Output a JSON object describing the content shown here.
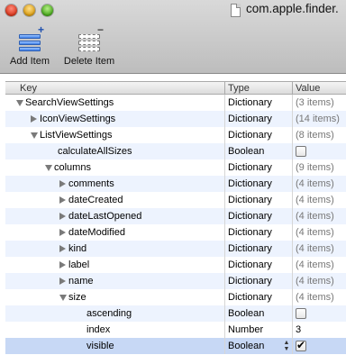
{
  "window": {
    "title": "com.apple.finder."
  },
  "toolbar": {
    "add_label": "Add Item",
    "delete_label": "Delete Item"
  },
  "columns": {
    "key": "Key",
    "type": "Type",
    "value": "Value"
  },
  "rows": [
    {
      "name": "row-searchviewsettings",
      "key": "SearchViewSettings",
      "depth": 0,
      "disclosure": "open",
      "type": "Dictionary",
      "value": "(3 items)"
    },
    {
      "name": "row-iconviewsettings",
      "key": "IconViewSettings",
      "depth": 1,
      "disclosure": "closed",
      "type": "Dictionary",
      "value": "(14 items)"
    },
    {
      "name": "row-listviewsettings",
      "key": "ListViewSettings",
      "depth": 1,
      "disclosure": "open",
      "type": "Dictionary",
      "value": "(8 items)"
    },
    {
      "name": "row-calculateallsizes",
      "key": "calculateAllSizes",
      "depth": 2,
      "disclosure": "none",
      "type": "Boolean",
      "checked": false
    },
    {
      "name": "row-columns",
      "key": "columns",
      "depth": 2,
      "disclosure": "open",
      "type": "Dictionary",
      "value": "(9 items)"
    },
    {
      "name": "row-comments",
      "key": "comments",
      "depth": 3,
      "disclosure": "closed",
      "type": "Dictionary",
      "value": "(4 items)"
    },
    {
      "name": "row-datecreated",
      "key": "dateCreated",
      "depth": 3,
      "disclosure": "closed",
      "type": "Dictionary",
      "value": "(4 items)"
    },
    {
      "name": "row-datelastopened",
      "key": "dateLastOpened",
      "depth": 3,
      "disclosure": "closed",
      "type": "Dictionary",
      "value": "(4 items)"
    },
    {
      "name": "row-datemodified",
      "key": "dateModified",
      "depth": 3,
      "disclosure": "closed",
      "type": "Dictionary",
      "value": "(4 items)"
    },
    {
      "name": "row-kind",
      "key": "kind",
      "depth": 3,
      "disclosure": "closed",
      "type": "Dictionary",
      "value": "(4 items)"
    },
    {
      "name": "row-label",
      "key": "label",
      "depth": 3,
      "disclosure": "closed",
      "type": "Dictionary",
      "value": "(4 items)"
    },
    {
      "name": "row-name",
      "key": "name",
      "depth": 3,
      "disclosure": "closed",
      "type": "Dictionary",
      "value": "(4 items)"
    },
    {
      "name": "row-size",
      "key": "size",
      "depth": 3,
      "disclosure": "open",
      "type": "Dictionary",
      "value": "(4 items)"
    },
    {
      "name": "row-ascending",
      "key": "ascending",
      "depth": 4,
      "disclosure": "none",
      "type": "Boolean",
      "checked": false
    },
    {
      "name": "row-index",
      "key": "index",
      "depth": 4,
      "disclosure": "none",
      "type": "Number",
      "value": "3",
      "dark": true
    },
    {
      "name": "row-visible",
      "key": "visible",
      "depth": 4,
      "disclosure": "none",
      "type": "Boolean",
      "checked": true,
      "selected": true,
      "stepper": true
    }
  ]
}
